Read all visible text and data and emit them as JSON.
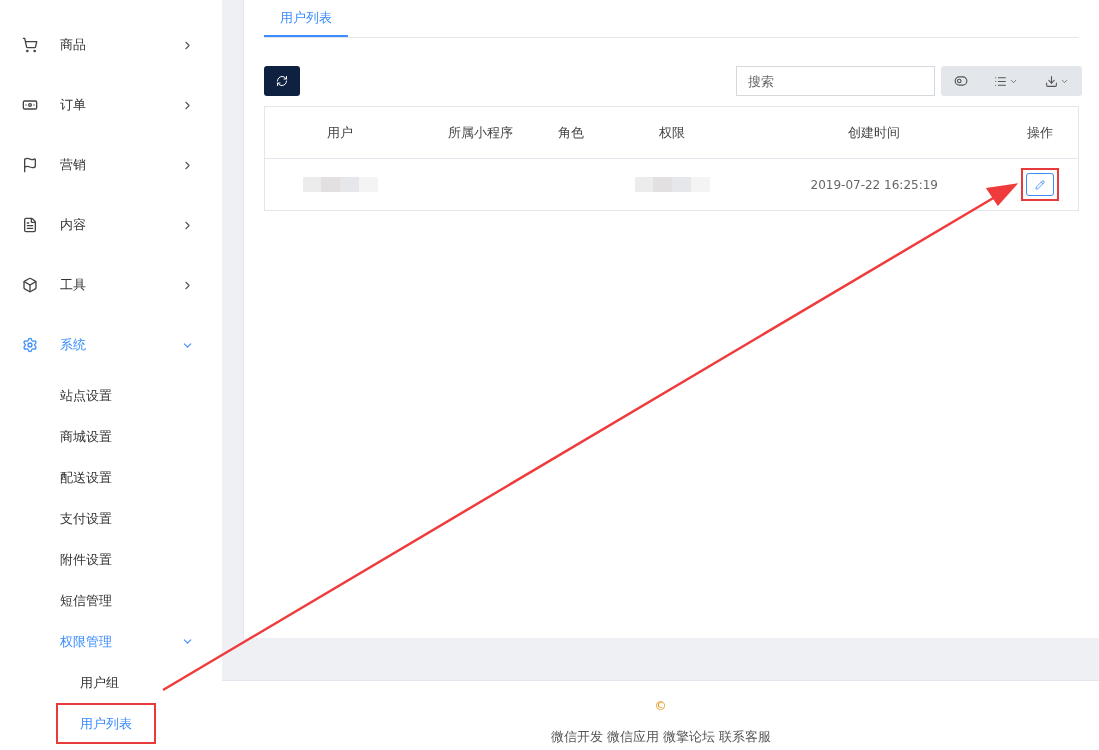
{
  "sidebar": {
    "items": [
      {
        "label": "商品",
        "expanded": false,
        "selected": false
      },
      {
        "label": "订单",
        "expanded": false,
        "selected": false
      },
      {
        "label": "营销",
        "expanded": false,
        "selected": false
      },
      {
        "label": "内容",
        "expanded": false,
        "selected": false
      },
      {
        "label": "工具",
        "expanded": false,
        "selected": false
      },
      {
        "label": "系统",
        "expanded": true,
        "selected": true,
        "children": [
          {
            "label": "站点设置",
            "expanded": false,
            "selected": false
          },
          {
            "label": "商城设置",
            "expanded": false,
            "selected": false
          },
          {
            "label": "配送设置",
            "expanded": false,
            "selected": false
          },
          {
            "label": "支付设置",
            "expanded": false,
            "selected": false
          },
          {
            "label": "附件设置",
            "expanded": false,
            "selected": false
          },
          {
            "label": "短信管理",
            "expanded": false,
            "selected": false
          },
          {
            "label": "权限管理",
            "expanded": true,
            "selected": true,
            "children": [
              {
                "label": "用户组",
                "selected": false,
                "highlighted": false
              },
              {
                "label": "用户列表",
                "selected": true,
                "highlighted": true
              }
            ]
          }
        ]
      }
    ]
  },
  "tabs": [
    {
      "label": "用户列表",
      "selected": true
    }
  ],
  "search": {
    "placeholder": "搜索"
  },
  "table": {
    "columns": [
      "用户",
      "所属小程序",
      "角色",
      "权限",
      "创建时间",
      "操作"
    ],
    "rows": [
      {
        "user_redacted": true,
        "permission_redacted": true,
        "created": "2019-07-22 16:25:19",
        "edit_highlighted": true
      }
    ]
  },
  "annotation": {
    "arrow": true
  },
  "footer": {
    "copyright": "©",
    "links": [
      "微信开发",
      "微信应用",
      "微擎论坛",
      "联系客服"
    ]
  }
}
